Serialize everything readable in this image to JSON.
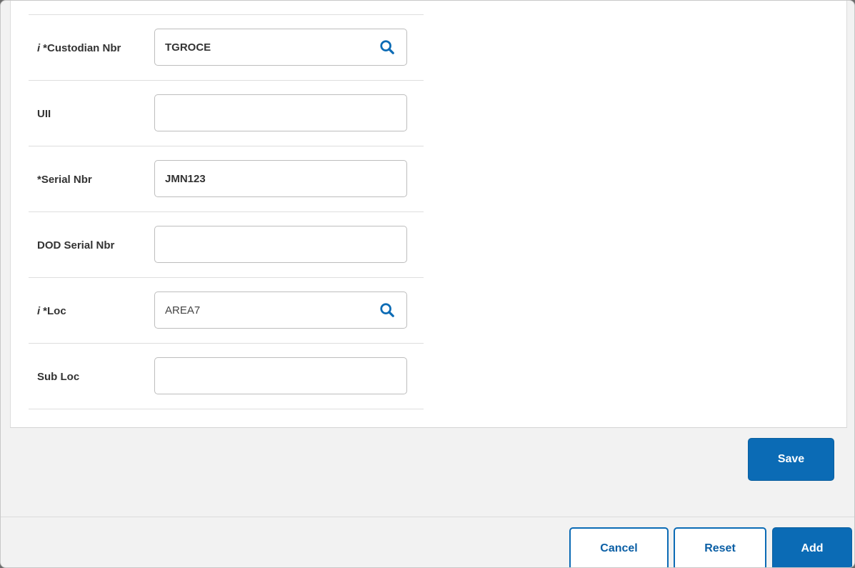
{
  "form": {
    "fields": [
      {
        "info": "i",
        "label": "*Custodian Nbr",
        "value": "TGROCE",
        "icon": "search-icon"
      },
      {
        "info": "",
        "label": "UII",
        "value": ""
      },
      {
        "info": "",
        "label": "*Serial Nbr",
        "value": "JMN123"
      },
      {
        "info": "",
        "label": "DOD Serial Nbr",
        "value": ""
      },
      {
        "info": "i",
        "label": "*Loc",
        "value": "AREA7",
        "icon": "search-icon"
      },
      {
        "info": "",
        "label": "Sub Loc",
        "value": ""
      }
    ]
  },
  "actions": {
    "save_label": "Save",
    "cancel_label": "Cancel",
    "reset_label": "Reset",
    "add_label": "Add"
  },
  "colors": {
    "primary": "#0b6bb5",
    "border": "#bdbdbd"
  }
}
